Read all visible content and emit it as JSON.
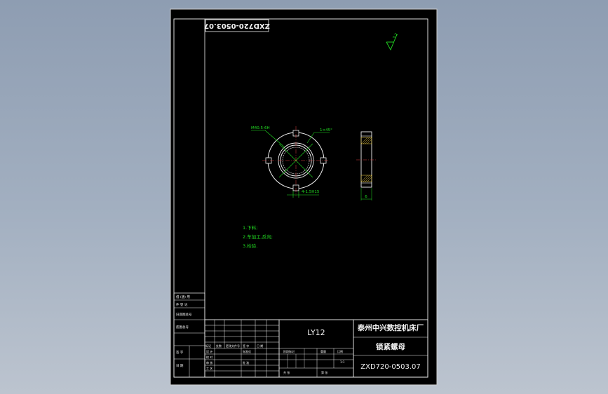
{
  "drawing": {
    "code_rotated": "ZXD720-0503.07",
    "roughness": "3.2"
  },
  "part_view": {
    "callouts": {
      "hole": "M40.5-6H",
      "chamfer": "1×45°",
      "slot": "4-1.5H15",
      "thickness": "6"
    }
  },
  "notes": [
    "1.下料;",
    "2.车加工,反向;",
    "3.检验."
  ],
  "side_stack": [
    "借 (通) 用",
    "件 登 记",
    "旧底图总号",
    "底图总号",
    "签 字",
    "日 期"
  ],
  "title_block": {
    "material": "LY12",
    "company": "泰州中兴数控机床厂",
    "part_name": "锁紧螺母",
    "drawing_number": "ZXD720-0503.07",
    "cells": {
      "mark": "标记",
      "count": "处数",
      "change_doc": "更改文件号",
      "signature": "签 字",
      "date": "日 期",
      "design": "设 计",
      "proofread": "校 对",
      "review": "审 核",
      "process": "工 艺",
      "standardize": "标准化",
      "approve": "批 准",
      "stage_mark": "阶段标记",
      "weight": "重量",
      "scale": "比例",
      "ratio": "1:1",
      "sheets_total": "共 张",
      "sheet_no": "第 张"
    }
  },
  "colors": {
    "sheet": "#000000",
    "lines": "#f2f2f2",
    "annotation": "#22dd22",
    "hatch": "#e0c040",
    "center": "#e04040"
  }
}
